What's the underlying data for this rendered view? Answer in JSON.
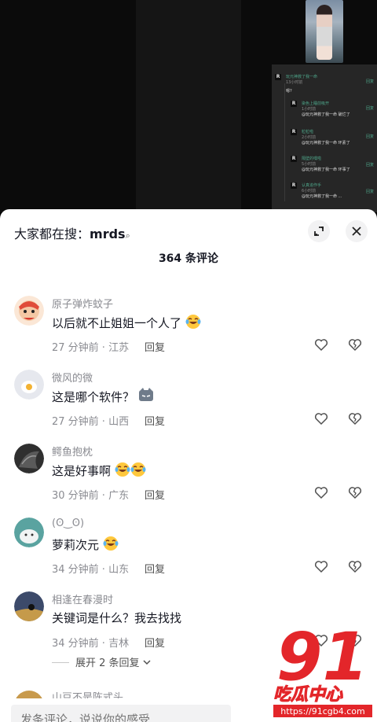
{
  "video": {
    "mini_comments": [
      {
        "name": "玩元神救了我一命",
        "time": "13小时前",
        "text": "嗯?"
      },
      {
        "name": "染色上睡前吸开",
        "time": "1小时前",
        "text": "@玩元神救了我一命 破烂了"
      },
      {
        "name": "粒粒啦",
        "time": "2小时前",
        "text": "@玩元神救了我一命 环素了"
      },
      {
        "name": "隔壁的嘿啦",
        "time": "5小时前",
        "text": "@玩元神救了我一命 环事了"
      },
      {
        "name": "认真追作手",
        "time": "6小时前",
        "text": "@玩元神救了我一命 ..."
      }
    ],
    "reply_label": "回复"
  },
  "sheet": {
    "search_prefix": "大家都在搜：",
    "search_term": "mrds",
    "comment_count": "364 条评论"
  },
  "comments": [
    {
      "name": "原子弹炸蚊子",
      "text": "以后就不止姐姐一个人了",
      "emoji": [
        "laugh-cry"
      ],
      "meta": "27 分钟前 · 江苏",
      "reply": "回复"
    },
    {
      "name": "微风的微",
      "text": "这是哪个软件？",
      "emoji": [
        "cat"
      ],
      "meta": "27 分钟前 · 山西",
      "reply": "回复"
    },
    {
      "name": "鳄鱼抱枕",
      "text": "这是好事啊",
      "emoji": [
        "laugh-cry",
        "laugh-cry"
      ],
      "meta": "30 分钟前 · 广东",
      "reply": "回复"
    },
    {
      "name": "(ʘ‿ʘ)",
      "text": "萝莉次元",
      "emoji": [
        "laugh-cry"
      ],
      "meta": "34 分钟前 · 山东",
      "reply": "回复"
    },
    {
      "name": "相逢在春漫时",
      "text": "关键词是什么？我去找找",
      "emoji": [],
      "meta": "34 分钟前 · 吉林",
      "reply": "回复"
    }
  ],
  "expand_replies": "展开 2 条回复",
  "partial_name": "山豆不是陈式头",
  "input": {
    "placeholder": "发条评论，说说你的感受"
  },
  "watermark": {
    "big": "91",
    "sub": "吃瓜中心",
    "url": "https://91cgb4.com"
  },
  "colors": {
    "accent": "#e3262a",
    "green": "#4ea68a"
  }
}
